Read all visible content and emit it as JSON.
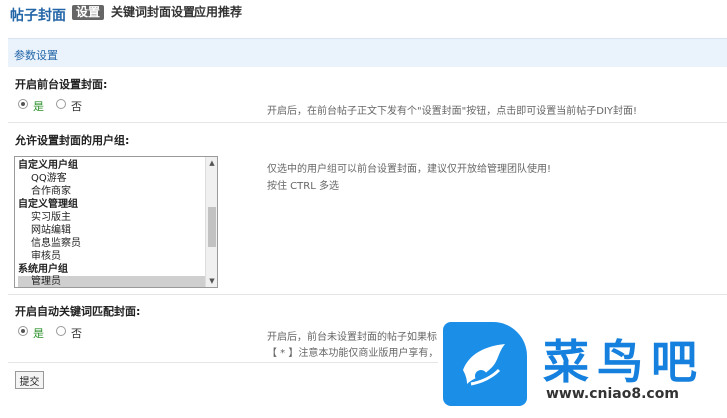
{
  "app": {
    "title": "帖子封面",
    "tabs": [
      {
        "label": "设置",
        "active": true
      },
      {
        "label": "关键词封面设置",
        "active": false
      },
      {
        "label": "应用推荐",
        "active": false
      }
    ]
  },
  "section": {
    "title": "参数设置"
  },
  "settings": {
    "front_cover": {
      "label": "开启前台设置封面:",
      "options": [
        {
          "label": "是",
          "checked": true
        },
        {
          "label": "否",
          "checked": false
        }
      ],
      "hint": "开启后，在前台帖子正文下发有个\"设置封面\"按钮，点击即可设置当前帖子DIY封面!"
    },
    "user_groups": {
      "label": "允许设置封面的用户组:",
      "hint_line1": "仅选中的用户组可以前台设置封面，建议仅开放给管理团队使用!",
      "hint_line2": "按住 CTRL 多选",
      "items": [
        {
          "label": "自定义用户组",
          "group": true,
          "selected": false
        },
        {
          "label": "QQ游客",
          "group": false,
          "selected": false
        },
        {
          "label": "合作商家",
          "group": false,
          "selected": false
        },
        {
          "label": "自定义管理组",
          "group": true,
          "selected": false
        },
        {
          "label": "实习版主",
          "group": false,
          "selected": false
        },
        {
          "label": "网站编辑",
          "group": false,
          "selected": false
        },
        {
          "label": "信息监察员",
          "group": false,
          "selected": false
        },
        {
          "label": "审核员",
          "group": false,
          "selected": false
        },
        {
          "label": "系统用户组",
          "group": true,
          "selected": false
        },
        {
          "label": "管理员",
          "group": false,
          "selected": true
        }
      ]
    },
    "auto_keyword": {
      "label": "开启自动关键词匹配封面:",
      "options": [
        {
          "label": "是",
          "checked": true
        },
        {
          "label": "否",
          "checked": false
        }
      ],
      "hint_line1": "开启后，前台未设置封面的帖子如果标",
      "hint_line2": "【 * 】注意本功能仅商业版用户享有，"
    }
  },
  "submit_label": "提交",
  "watermark": {
    "name": "菜鸟吧",
    "url": "www.cniao8.com"
  },
  "colors": {
    "accent": "#2366a8",
    "section_bg": "#eaf2fb",
    "yes_green": "#2a8f2a",
    "logo_blue": "#1b8ee8"
  }
}
